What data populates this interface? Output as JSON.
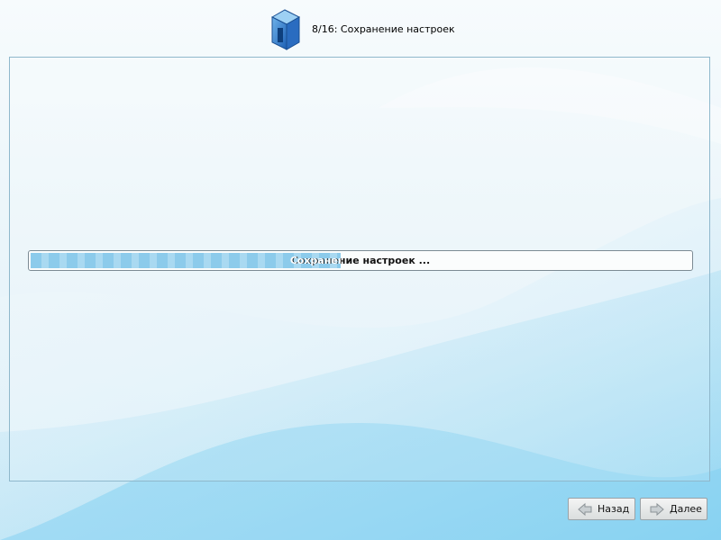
{
  "header": {
    "title": "8/16: Сохранение настроек",
    "logo_icon": "installer-box-icon"
  },
  "progress": {
    "label": "Сохранение настроек ...",
    "percent": 47
  },
  "buttons": {
    "back_label": "Назад",
    "next_label": "Далее"
  },
  "colors": {
    "progress_fill": "#8ccbeb",
    "panel_border": "#8fb8cc"
  }
}
